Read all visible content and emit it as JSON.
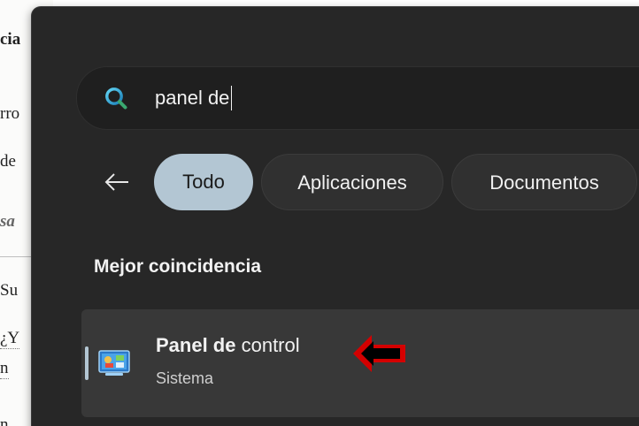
{
  "background_document": {
    "fragments": [
      "cia",
      "rro",
      "de",
      "sa",
      "Su",
      "¿Y",
      "n",
      "n"
    ]
  },
  "search": {
    "query": "panel de"
  },
  "filters": {
    "back_label": "Atrás",
    "tabs": [
      {
        "label": "Todo",
        "active": true
      },
      {
        "label": "Aplicaciones",
        "active": false
      },
      {
        "label": "Documentos",
        "active": false
      }
    ]
  },
  "best_match": {
    "heading": "Mejor coincidencia",
    "result": {
      "title_bold": "Panel de",
      "title_rest": " control",
      "subtitle": "Sistema",
      "icon": "control-panel-icon"
    }
  },
  "annotation": {
    "icon": "red-arrow-pointer",
    "color": "#d40000"
  },
  "colors": {
    "panel_bg": "#272727",
    "search_bg": "#1f1f1f",
    "chip_active": "#b3c6d3",
    "chip_inactive": "#303030",
    "card_bg": "#383838"
  }
}
